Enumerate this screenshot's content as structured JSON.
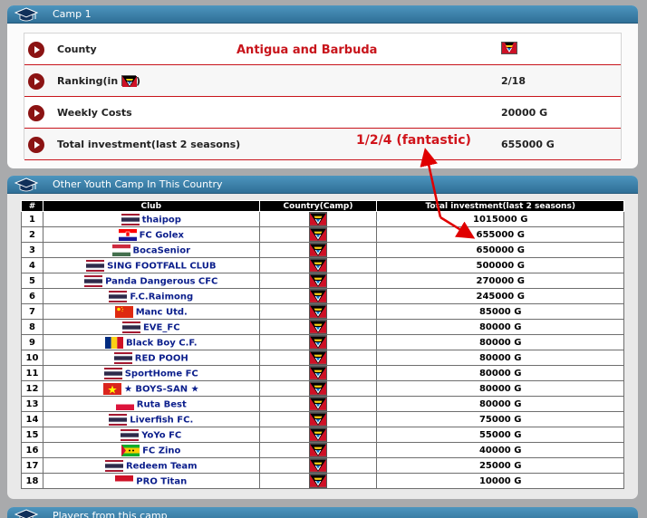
{
  "camp1": {
    "title": "Camp 1",
    "rows": [
      {
        "label": "County",
        "value": "",
        "country": "Antigua and Barbuda"
      },
      {
        "label_pre": "Ranking(in ",
        "label_post": ")",
        "value": "2/18"
      },
      {
        "label": "Weekly Costs",
        "value": "20000 G"
      },
      {
        "label": "Total investment(last 2 seasons)",
        "value": "655000 G"
      }
    ]
  },
  "annotation": "1/2/4 (fantastic)",
  "others": {
    "title": "Other Youth Camp In This Country",
    "headers": {
      "num": "#",
      "club": "Club",
      "country": "Country(Camp)",
      "investment": "Total investment(last 2 seasons)"
    },
    "rows": [
      {
        "num": "1",
        "club": "thaipop",
        "flag": "th",
        "investment": "1015000 G"
      },
      {
        "num": "2",
        "club": "FC Golex",
        "flag": "hr",
        "investment": "655000 G"
      },
      {
        "num": "3",
        "club": "BocaSenior",
        "flag": "hu",
        "investment": "650000 G"
      },
      {
        "num": "4",
        "club": "SING FOOTFALL CLUB",
        "flag": "th",
        "investment": "500000 G"
      },
      {
        "num": "5",
        "club": "Panda Dangerous CFC",
        "flag": "th",
        "investment": "270000 G"
      },
      {
        "num": "6",
        "club": "F.C.Raimong",
        "flag": "th",
        "investment": "245000 G"
      },
      {
        "num": "7",
        "club": "Manc Utd.",
        "flag": "cn",
        "investment": "85000 G"
      },
      {
        "num": "8",
        "club": "EVE_FC",
        "flag": "th",
        "investment": "80000 G"
      },
      {
        "num": "9",
        "club": "Black Boy C.F.",
        "flag": "ro",
        "investment": "80000 G"
      },
      {
        "num": "10",
        "club": "RED POOH",
        "flag": "th",
        "investment": "80000 G"
      },
      {
        "num": "11",
        "club": "SportHome FC",
        "flag": "th",
        "investment": "80000 G"
      },
      {
        "num": "12",
        "club": "★ BOYS-SAN ★",
        "flag": "vn",
        "investment": "80000 G"
      },
      {
        "num": "13",
        "club": "Ruta Best",
        "flag": "pl",
        "investment": "80000 G"
      },
      {
        "num": "14",
        "club": "Liverfish FC.",
        "flag": "th",
        "investment": "75000 G"
      },
      {
        "num": "15",
        "club": "YoYo FC",
        "flag": "th",
        "investment": "55000 G"
      },
      {
        "num": "16",
        "club": "FC Zino",
        "flag": "st",
        "investment": "40000 G"
      },
      {
        "num": "17",
        "club": "Redeem Team",
        "flag": "th",
        "investment": "25000 G"
      },
      {
        "num": "18",
        "club": "PRO Titan",
        "flag": "id",
        "investment": "10000 G"
      }
    ]
  },
  "players": {
    "title": "Players from this camp"
  },
  "colors": {
    "accent": "#c8141b",
    "header": "#2f6f97",
    "link": "#0c1f8c"
  },
  "icons": {
    "panel": "graduation-cap-icon",
    "row": "play-circle-icon",
    "flag": "antigua-flag-icon"
  }
}
